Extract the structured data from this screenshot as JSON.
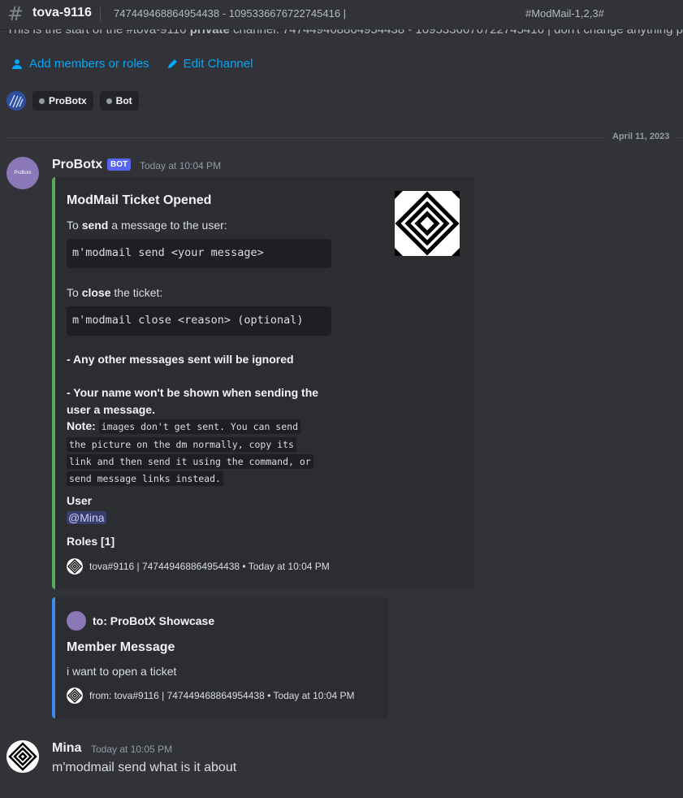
{
  "header": {
    "channel_name": "tova-9116",
    "topic": "747449468864954438 - 1095336676722745416 |",
    "topic_right": "#ModMail-1,2,3#"
  },
  "channel_start": {
    "text_prefix": "This is the start of the #tova-9116 ",
    "text_bold": "private",
    "text_suffix": " channel. 747449468864954438 - 1095336676722745416 | don't change anything p"
  },
  "actions": {
    "add_members_label": "Add members or roles",
    "edit_channel_label": "Edit Channel"
  },
  "members": {
    "chip1": "ProBotx",
    "chip2": "Bot"
  },
  "date_separator": "April 11, 2023",
  "message1": {
    "avatar_text": "ProBotx",
    "username": "ProBotx",
    "badge": "BOT",
    "timestamp": "Today at 10:04 PM",
    "embed": {
      "title": "ModMail Ticket Opened",
      "line_send_pre": "To ",
      "line_send_bold": "send",
      "line_send_post": " a message to the user:",
      "code_send": "m'modmail send <your message>",
      "line_close_pre": "To ",
      "line_close_bold": "close",
      "line_close_post": " the ticket:",
      "code_close": "m'modmail close <reason> (optional)",
      "bullet1": "- Any other messages sent will be ignored",
      "bullet2_line1": "- Your name won't be shown when sending the",
      "bullet2_line2": "user a message.",
      "note_label": "Note:",
      "note_line1": "images don't get sent. You can send",
      "note_line2": "the picture on the dm normally, copy its",
      "note_line3": "link and then send it using the command, or",
      "note_line4": "send message links instead.",
      "field_user": "User",
      "field_user_value": "@Mina",
      "field_roles": "Roles [1]",
      "footer": "tova#9116 | 747449468864954438 • Today at 10:04 PM"
    }
  },
  "embed2": {
    "author": "to: ProBotX Showcase",
    "title": "Member Message",
    "description": "i want to open a ticket",
    "footer": "from: tova#9116 | 747449468864954438 • Today at 10:04 PM"
  },
  "message2": {
    "username": "Mina",
    "timestamp": "Today at 10:05 PM",
    "content": "m'modmail send what is it about"
  },
  "colors": {
    "background": "#313338",
    "embed_bg": "#2b2d31",
    "embed1_bar": "#57ab5a",
    "embed2_bar": "#3c8cf0",
    "link": "#00a8fc",
    "bot_badge": "#5865f2"
  }
}
